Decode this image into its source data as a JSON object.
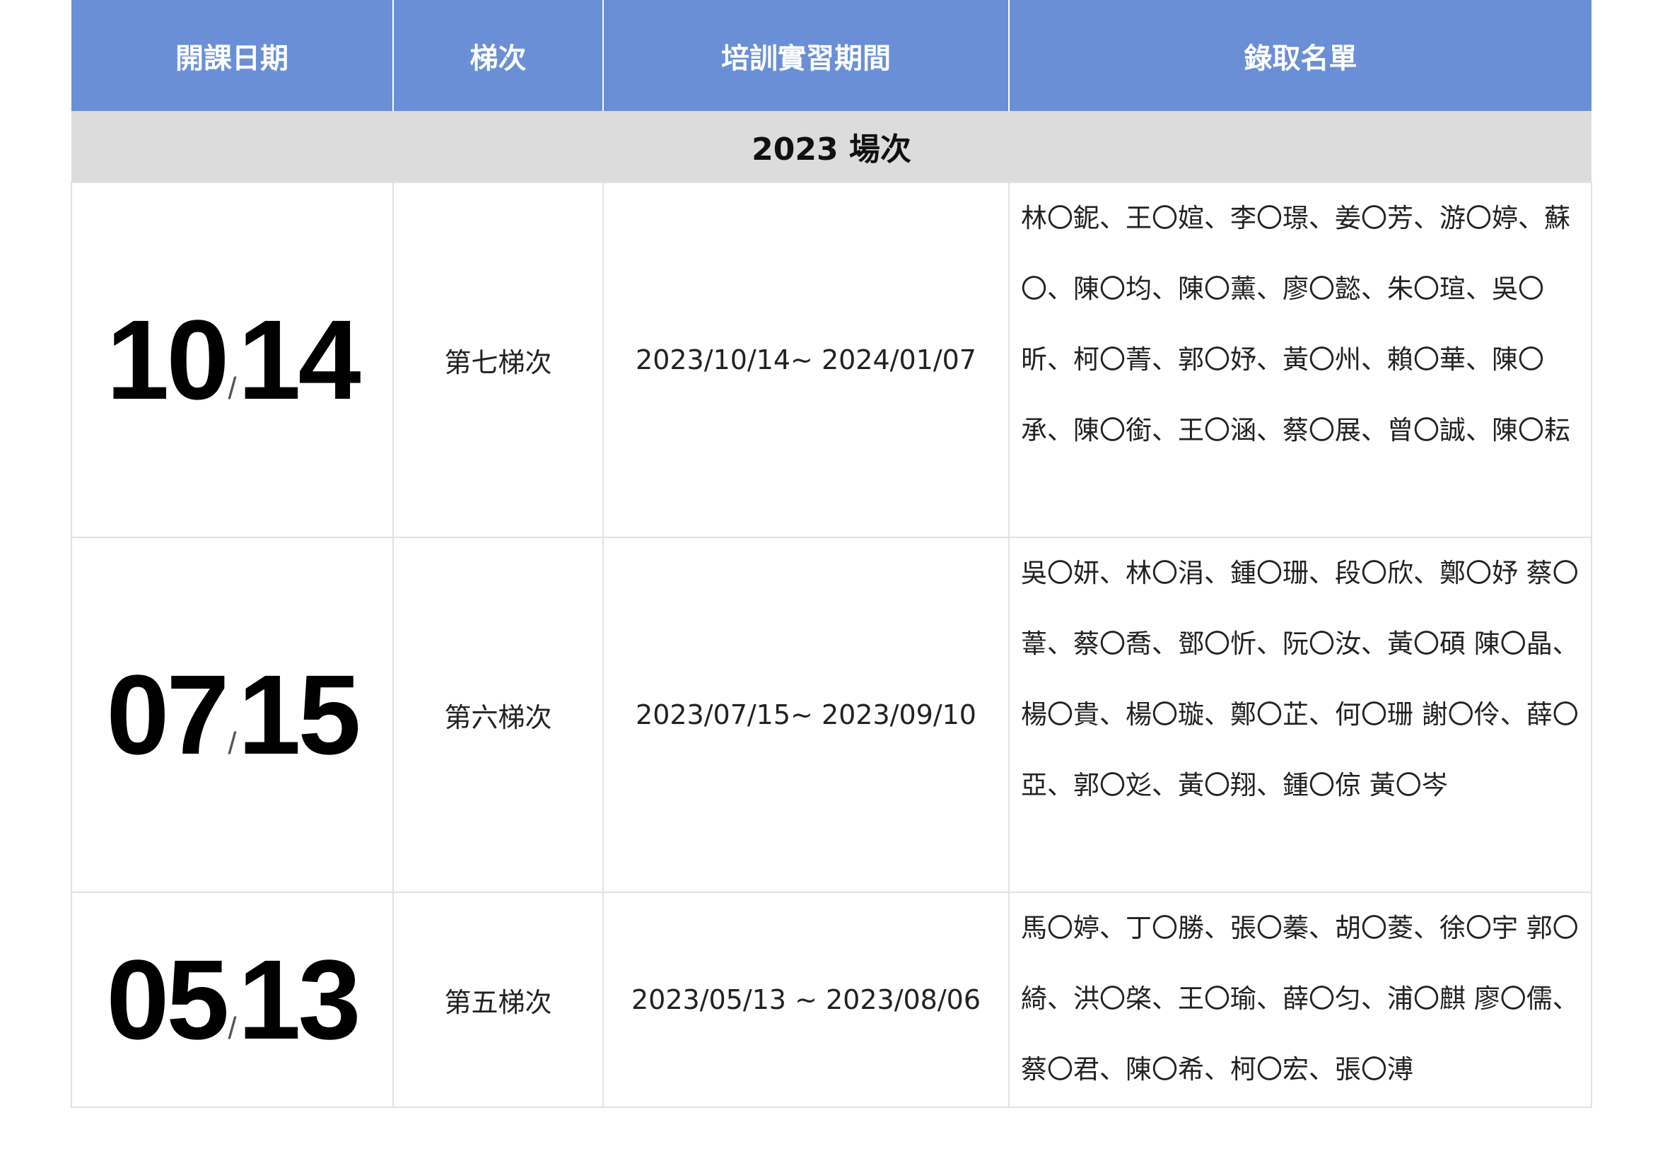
{
  "header": {
    "col_date": "開課日期",
    "col_batch": "梯次",
    "col_period": "培訓實習期間",
    "col_names": "錄取名單"
  },
  "section": {
    "label": "2023 場次"
  },
  "rows": [
    {
      "month": "10",
      "slash": "/",
      "day": "14",
      "batch": "第七梯次",
      "period": "2023/10/14~ 2024/01/07",
      "names": "林〇鈮、王〇媗、李〇璟、姜〇芳、游〇婷、蘇〇、陳〇均、陳〇薰、廖〇懿、朱〇瑄、吳〇昕、柯〇菁、郭〇妤、黃〇州、賴〇華、陳〇承、陳〇銜、王〇涵、蔡〇展、曾〇誠、陳〇耘"
    },
    {
      "month": "07",
      "slash": "/",
      "day": "15",
      "batch": "第六梯次",
      "period": "2023/07/15~ 2023/09/10",
      "names": "吳〇妍、林〇涓、鍾〇珊、段〇欣、鄭〇妤 蔡〇葦、蔡〇喬、鄧〇忻、阮〇汝、黃〇碩 陳〇晶、楊〇貴、楊〇璇、鄭〇芷、何〇珊 謝〇伶、薛〇亞、郭〇彣、黃〇翔、鍾〇倞 黃〇岑"
    },
    {
      "month": "05",
      "slash": "/",
      "day": "13",
      "batch": "第五梯次",
      "period": "2023/05/13 ~ 2023/08/06",
      "names": "馬〇婷、丁〇勝、張〇蓁、胡〇菱、徐〇宇 郭〇綺、洪〇棨、王〇瑜、薛〇匀、浦〇麒 廖〇儒、蔡〇君、陳〇希、柯〇宏、張〇溥"
    }
  ]
}
